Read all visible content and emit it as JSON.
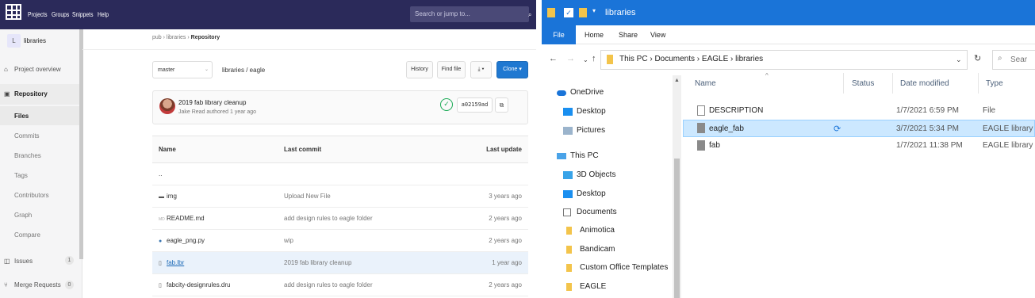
{
  "gitlab": {
    "top_nav": [
      "Projects",
      "Groups",
      "Snippets",
      "Help"
    ],
    "search_placeholder": "Search or jump to...",
    "project": {
      "initial": "L",
      "name": "libraries"
    },
    "sidebar": {
      "project_overview": "Project overview",
      "repository": "Repository",
      "repo_items": [
        "Files",
        "Commits",
        "Branches",
        "Tags",
        "Contributors",
        "Graph",
        "Compare"
      ],
      "issues": "Issues",
      "issues_count": "1",
      "merge_requests": "Merge Requests",
      "merge_requests_count": "0"
    },
    "breadcrumb": {
      "parts": "pub › libraries ›",
      "current": "Repository"
    },
    "branch": "master",
    "path": "libraries / eagle",
    "buttons": {
      "history": "History",
      "find_file": "Find file",
      "download": "⤓ ▾",
      "clone": "Clone ▾"
    },
    "last_commit": {
      "title": "2019 fab library cleanup",
      "author": "Jake Read authored 1 year ago",
      "sha": "a0215​9ad"
    },
    "table": {
      "headers": {
        "name": "Name",
        "last_commit": "Last commit",
        "last_update": "Last update"
      },
      "parent": "..",
      "rows": [
        {
          "name": "img",
          "commit": "Upload New File",
          "update": "3 years ago"
        },
        {
          "name": "README.md",
          "commit": "add design rules to eagle folder",
          "update": "2 years ago"
        },
        {
          "name": "eagle_png.py",
          "commit": "wip",
          "update": "2 years ago"
        },
        {
          "name": "fab.lbr",
          "commit": "2019 fab library cleanup",
          "update": "1 year ago"
        },
        {
          "name": "fabcity-designrules.dru",
          "commit": "add design rules to eagle folder",
          "update": "2 years ago"
        }
      ]
    }
  },
  "explorer": {
    "title": "libraries",
    "ribbon_tabs": [
      "File",
      "Home",
      "Share",
      "View"
    ],
    "address_path": "This PC  ›  Documents  ›  EAGLE  ›  libraries",
    "search_placeholder": "Sear",
    "nav_items": [
      "OneDrive",
      "Desktop",
      "Pictures",
      "This PC",
      "3D Objects",
      "Desktop",
      "Documents",
      "Animotica",
      "Bandicam",
      "Custom Office Templates",
      "EAGLE"
    ],
    "columns": {
      "name": "Name",
      "status": "Status",
      "date": "Date modified",
      "type": "Type"
    },
    "files": [
      {
        "name": "DESCRIPTION",
        "date": "1/7/2021 6:59 PM",
        "type": "File",
        "status": ""
      },
      {
        "name": "eagle_fab",
        "date": "3/7/2021 5:34 PM",
        "type": "EAGLE library",
        "status": "⟳"
      },
      {
        "name": "fab",
        "date": "1/7/2021 11:38 PM",
        "type": "EAGLE library",
        "status": ""
      }
    ],
    "colors": {
      "title_bar": "#1a74d8",
      "selection": "#cce8ff",
      "folder": "#f3c44b"
    }
  }
}
